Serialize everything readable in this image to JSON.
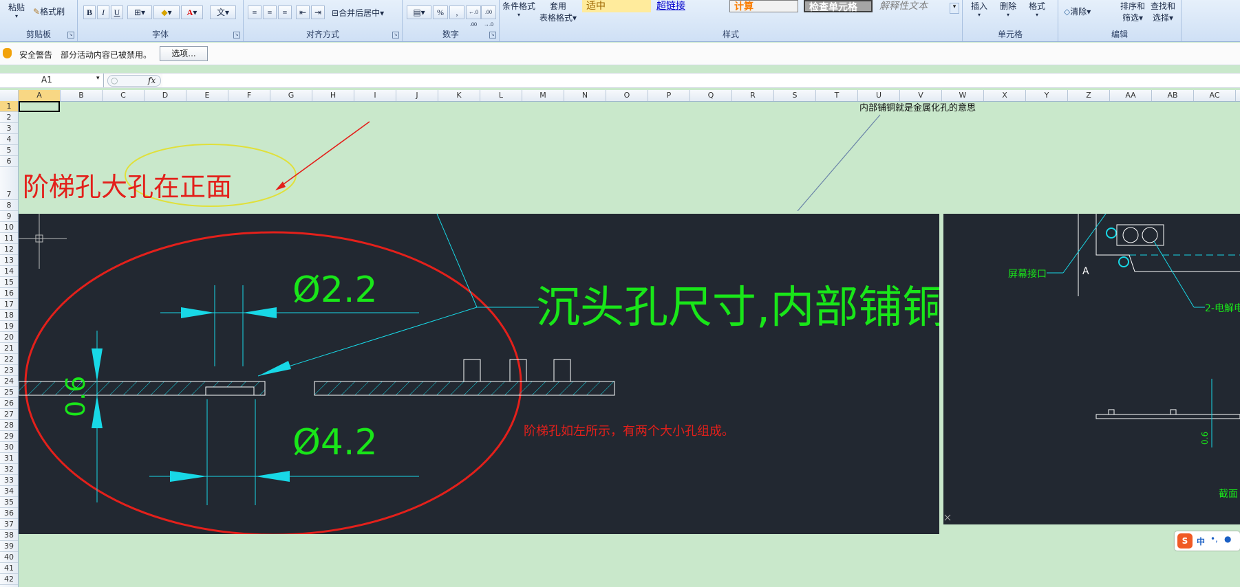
{
  "ribbon": {
    "paste": "粘贴",
    "format_painter": "格式刷",
    "clipboard_label": "剪贴板",
    "bold": "B",
    "italic": "I",
    "underline": "U",
    "font_label": "字体",
    "merge_center": "合并后居中",
    "alignment_label": "对齐方式",
    "percent": "%",
    "comma": ",",
    "inc_decimal": "←.0 .00",
    "dec_decimal": ".00 →.0",
    "number_label": "数字",
    "conditional_format": "条件格式",
    "format_as_table_1": "套用",
    "format_as_table_2": "表格格式",
    "style_neutral": "适中",
    "style_hyperlink": "超链接",
    "style_calc": "计算",
    "style_check": "检查单元格",
    "style_explain": "解释性文本",
    "styles_label": "样式",
    "insert": "插入",
    "delete": "删除",
    "format": "格式",
    "cells_label": "单元格",
    "clear": "清除",
    "sort_filter_1": "排序和",
    "sort_filter_2": "筛选",
    "find_select_1": "查找和",
    "find_select_2": "选择",
    "editing_label": "编辑"
  },
  "security_bar": {
    "title": "安全警告",
    "message": "部分活动内容已被禁用。",
    "options_button": "选项..."
  },
  "formula_bar": {
    "name_box": "A1",
    "fx": "fx",
    "formula": ""
  },
  "columns": [
    "A",
    "B",
    "C",
    "D",
    "E",
    "F",
    "G",
    "H",
    "I",
    "J",
    "K",
    "L",
    "M",
    "N",
    "O",
    "P",
    "Q",
    "R",
    "S",
    "T",
    "U",
    "V",
    "W",
    "X",
    "Y",
    "Z",
    "AA",
    "AB",
    "AC"
  ],
  "rows": [
    "1",
    "2",
    "3",
    "4",
    "5",
    "6",
    "7",
    "8",
    "9",
    "10",
    "11",
    "12",
    "13",
    "14",
    "15",
    "16",
    "17",
    "18",
    "19",
    "20",
    "21",
    "22",
    "23",
    "24",
    "25",
    "26",
    "27",
    "28",
    "29",
    "30",
    "31",
    "32",
    "33",
    "34",
    "35",
    "36",
    "37",
    "38",
    "39",
    "40",
    "41",
    "42"
  ],
  "annotations": {
    "step_hole_front": "阶梯孔大孔在正面",
    "inner_copper_note": "内部铺铜就是金属化孔的意思"
  },
  "drawing_left": {
    "diameter_small": "Ø2.2",
    "diameter_large": "Ø4.2",
    "thickness": "0.6",
    "countersink_title": "沉头孔尺寸,内部铺铜",
    "step_hole_desc": "阶梯孔如左所示，有两个大小孔组成。"
  },
  "drawing_right": {
    "screen_interface": "屏幕接口",
    "point_a": "A",
    "electrolytic": "2-电解电",
    "thickness": "0.6",
    "section": "截面"
  },
  "ime": {
    "label": "中"
  },
  "colors": {
    "sheet_bg": "#c9e8cb",
    "cad_bg": "#222831",
    "cad_cyan": "#18d8e6",
    "cad_green": "#19e619",
    "annotation_red": "#e3201b",
    "ellipse_yellow": "#e0e03a"
  }
}
